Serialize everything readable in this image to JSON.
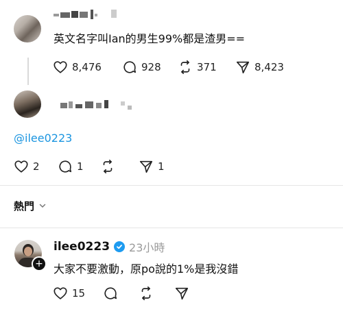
{
  "post": {
    "text": "英文名字叫Ian的男生99%都是渣男==",
    "actions": {
      "likes": "8,476",
      "comments": "928",
      "reposts": "371",
      "shares": "8,423"
    }
  },
  "reply1": {
    "text": "@ilee0223",
    "actions": {
      "likes": "2",
      "comments": "1",
      "reposts": "",
      "shares": "1"
    }
  },
  "sort": {
    "label": "熱門"
  },
  "reply2": {
    "username": "ilee0223",
    "time": "23小時",
    "text": "大家不要激動，原po說的1%是我沒錯",
    "actions": {
      "likes": "15"
    }
  },
  "icons": {
    "like": "heart-icon",
    "comment": "comment-bubble-icon",
    "repost": "repost-icon",
    "share": "send-icon",
    "verified": "verified-badge-icon",
    "follow": "plus-icon",
    "chevron": "chevron-down-icon"
  },
  "colors": {
    "mention": "#1b95e0",
    "verified": "#1d9bf0",
    "muted": "#9a9a9a"
  }
}
